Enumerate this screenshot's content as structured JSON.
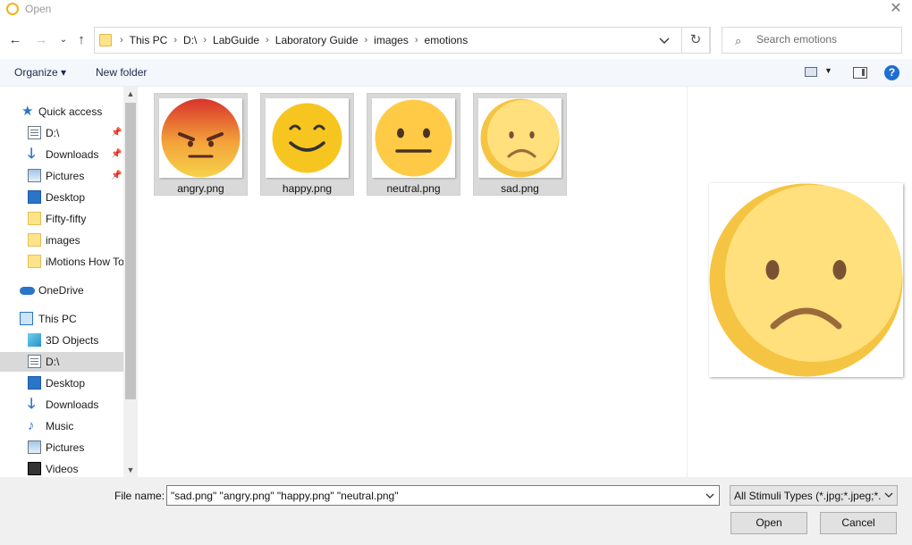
{
  "window": {
    "title": "Open",
    "close_icon": "close-icon"
  },
  "nav": {
    "back_icon": "arrow-left-icon",
    "forward_icon": "arrow-right-icon",
    "recent_icon": "chevron-down-icon",
    "up_icon": "arrow-up-icon",
    "breadcrumbs": [
      "This PC",
      "D:\\",
      "LabGuide",
      "Laboratory Guide",
      "images",
      "emotions"
    ],
    "refresh_icon": "refresh-icon"
  },
  "search": {
    "placeholder": "Search emotions",
    "value": ""
  },
  "toolbar": {
    "organize_label": "Organize ▾",
    "new_folder_label": "New folder"
  },
  "sidebar": {
    "quick_access": "Quick access",
    "quick_items": [
      {
        "label": "D:\\",
        "icon": "drive-icon",
        "pinned": true
      },
      {
        "label": "Downloads",
        "icon": "download-icon",
        "pinned": true
      },
      {
        "label": "Pictures",
        "icon": "pictures-icon",
        "pinned": true
      },
      {
        "label": "Desktop",
        "icon": "desktop-icon"
      },
      {
        "label": "Fifty-fifty",
        "icon": "folder-icon"
      },
      {
        "label": "images",
        "icon": "folder-icon"
      },
      {
        "label": "iMotions How To",
        "icon": "folder-icon"
      }
    ],
    "onedrive": "OneDrive",
    "this_pc": "This PC",
    "pc_items": [
      {
        "label": "3D Objects",
        "icon": "3d-objects-icon"
      },
      {
        "label": "D:\\",
        "icon": "drive-icon",
        "selected": true
      },
      {
        "label": "Desktop",
        "icon": "desktop-icon"
      },
      {
        "label": "Downloads",
        "icon": "download-icon"
      },
      {
        "label": "Music",
        "icon": "music-icon"
      },
      {
        "label": "Pictures",
        "icon": "pictures-icon"
      },
      {
        "label": "Videos",
        "icon": "videos-icon"
      }
    ]
  },
  "files": [
    {
      "name": "angry.png",
      "emotion": "angry",
      "selected": true
    },
    {
      "name": "happy.png",
      "emotion": "happy",
      "selected": true
    },
    {
      "name": "neutral.png",
      "emotion": "neutral",
      "selected": true
    },
    {
      "name": "sad.png",
      "emotion": "sad",
      "selected": true
    }
  ],
  "preview": {
    "emotion": "sad"
  },
  "bottom": {
    "file_name_label": "File name:",
    "file_name_value": "\"sad.png\" \"angry.png\" \"happy.png\" \"neutral.png\"",
    "file_type_value": "All Stimuli Types (*.jpg;*.jpeg;*.png)",
    "open_label": "Open",
    "cancel_label": "Cancel"
  },
  "colors": {
    "accent": "#2a74c9",
    "selection": "#d9d9d9",
    "emoji_yellow": "#ffd24c",
    "sad_yellow": "#ffe07d"
  }
}
